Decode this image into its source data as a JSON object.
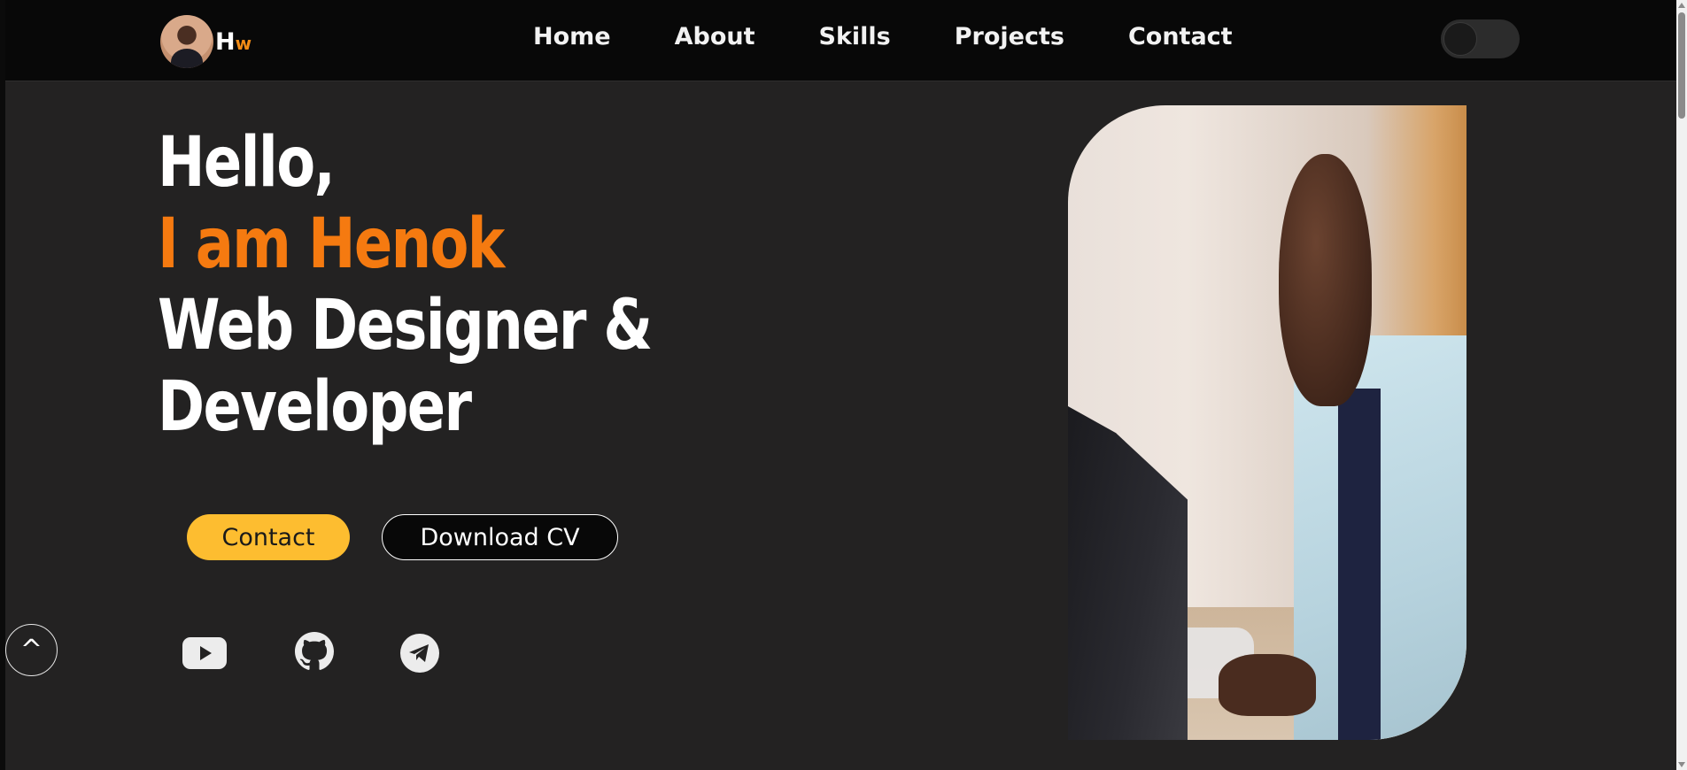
{
  "navbar": {
    "brand": {
      "h": "H",
      "w": "w"
    },
    "links": [
      "Home",
      "About",
      "Skills",
      "Projects",
      "Contact"
    ],
    "theme_toggle_icon": "toggle-icon"
  },
  "hero": {
    "line1": "Hello,",
    "line2": "I am Henok",
    "line3": "Web Designer &",
    "line4": "Developer",
    "contact_button": "Contact",
    "cv_button": "Download CV",
    "social_icons": [
      "youtube-icon",
      "github-icon",
      "telegram-icon"
    ],
    "back_to_top": "^"
  },
  "colors": {
    "background": "#232222",
    "navbar": "#080808",
    "accent_orange": "#f57a10",
    "contact_button": "#fdbd30"
  }
}
